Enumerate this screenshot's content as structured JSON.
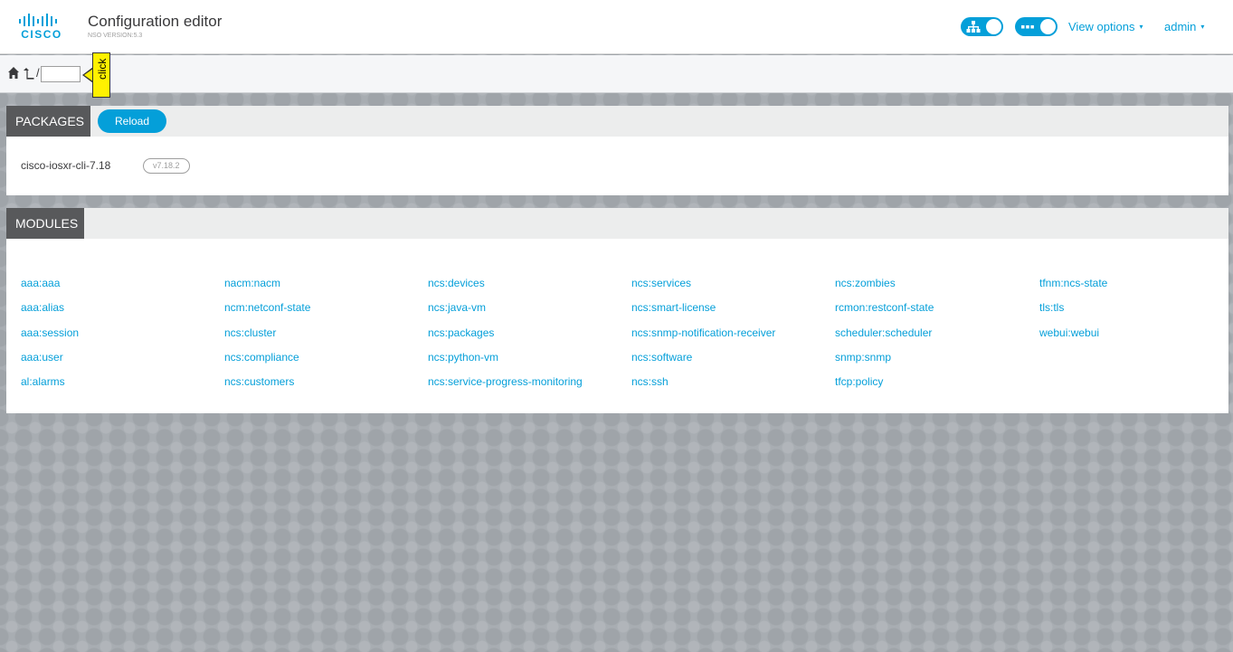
{
  "header": {
    "logo_text": "CISCO",
    "title": "Configuration editor",
    "version": "NSO VERSION:5.3",
    "view_options_label": "View options",
    "user_label": "admin",
    "caret": "▾"
  },
  "breadcrumb": {
    "separator": "/",
    "path_value": "",
    "tooltip_label": "click"
  },
  "packages": {
    "title": "PACKAGES",
    "reload_label": "Reload",
    "items": [
      {
        "name": "cisco-iosxr-cli-7.18",
        "version": "v7.18.2"
      }
    ]
  },
  "modules": {
    "title": "MODULES",
    "columns": [
      [
        "aaa:aaa",
        "aaa:alias",
        "aaa:session",
        "aaa:user",
        "al:alarms"
      ],
      [
        "nacm:nacm",
        "ncm:netconf-state",
        "ncs:cluster",
        "ncs:compliance",
        "ncs:customers"
      ],
      [
        "ncs:devices",
        "ncs:java-vm",
        "ncs:packages",
        "ncs:python-vm",
        "ncs:service-progress-monitoring"
      ],
      [
        "ncs:services",
        "ncs:smart-license",
        "ncs:snmp-notification-receiver",
        "ncs:software",
        "ncs:ssh"
      ],
      [
        "ncs:zombies",
        "rcmon:restconf-state",
        "scheduler:scheduler",
        "snmp:snmp",
        "tfcp:policy"
      ],
      [
        "tfnm:ncs-state",
        "tls:tls",
        "webui:webui"
      ]
    ]
  },
  "colors": {
    "accent": "#049fd9",
    "panel_title_bg": "#58595b",
    "tooltip": "#fff100"
  },
  "icons": {
    "home": "home-icon",
    "up": "level-up-icon",
    "tree_toggle": "tree-icon",
    "dots_toggle": "more-icon"
  }
}
